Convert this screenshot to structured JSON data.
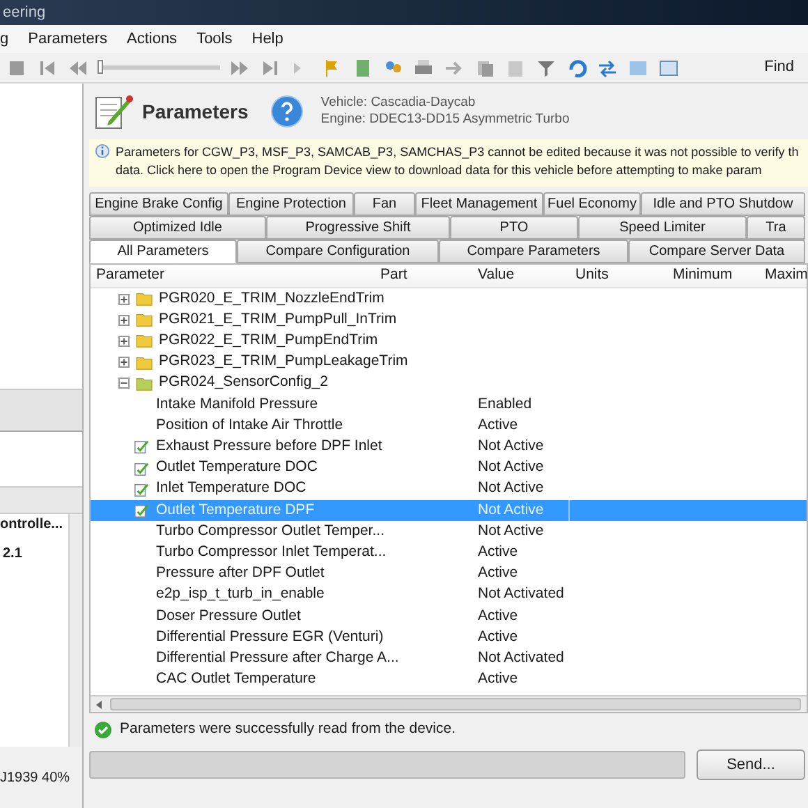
{
  "window": {
    "title": "eering"
  },
  "menu": [
    {
      "label": "g"
    },
    {
      "label": "Parameters"
    },
    {
      "label": "Actions"
    },
    {
      "label": "Tools"
    },
    {
      "label": "Help"
    }
  ],
  "toolbar": {
    "find_label": "Find",
    "slider": {
      "level": 0.0
    }
  },
  "left_panel": {
    "column_header": "ontrolle...",
    "version": "2.1",
    "status": "J1939 40%"
  },
  "header": {
    "title": "Parameters",
    "vehicle": "Vehicle: Cascadia-Daycab",
    "engine": "Engine: DDEC13-DD15 Asymmetric Turbo"
  },
  "banner": {
    "line_1": "Parameters for CGW_P3, MSF_P3, SAMCAB_P3, SAMCHAS_P3 cannot be edited because it was not possible to verify th",
    "line_2": "data. Click here to open the Program Device view to download data for this vehicle before attempting to make param"
  },
  "tab_rows": [
    [
      {
        "label": "Engine Brake Config",
        "selected": false
      },
      {
        "label": "Engine Protection",
        "selected": false
      },
      {
        "label": "Fan",
        "selected": false
      },
      {
        "label": "Fleet Management",
        "selected": false
      },
      {
        "label": "Fuel Economy",
        "selected": false
      },
      {
        "label": "Idle and PTO Shutdow",
        "selected": false
      }
    ],
    [
      {
        "label": "Optimized Idle",
        "selected": false
      },
      {
        "label": "Progressive Shift",
        "selected": false
      },
      {
        "label": "PTO",
        "selected": false
      },
      {
        "label": "Speed Limiter",
        "selected": false
      },
      {
        "label": "Tra",
        "selected": false
      }
    ],
    [
      {
        "label": "All Parameters",
        "selected": true
      },
      {
        "label": "Compare Configuration",
        "selected": false
      },
      {
        "label": "Compare Parameters",
        "selected": false
      },
      {
        "label": "Compare Server Data",
        "selected": false
      }
    ]
  ],
  "table": {
    "columns": [
      "Parameter",
      "Part",
      "Value",
      "Units",
      "Minimum",
      "Maxim"
    ],
    "rows": [
      {
        "name": "PGR020_E_TRIM_NozzleEndTrim",
        "expanded": false,
        "children": []
      },
      {
        "name": "PGR021_E_TRIM_PumpPull_InTrim",
        "expanded": false,
        "children": []
      },
      {
        "name": "PGR022_E_TRIM_PumpEndTrim",
        "expanded": false,
        "children": []
      },
      {
        "name": "PGR023_E_TRIM_PumpLeakageTrim",
        "expanded": false,
        "children": []
      },
      {
        "name": "PGR024_SensorConfig_2",
        "expanded": true,
        "children": [
          {
            "name": "Intake Manifold Pressure",
            "value": "Enabled",
            "edited": false,
            "selected": false
          },
          {
            "name": "Position of Intake Air Throttle",
            "value": "Active",
            "edited": false,
            "selected": false
          },
          {
            "name": "Exhaust Pressure before DPF Inlet",
            "value": "Not Active",
            "edited": true,
            "selected": false
          },
          {
            "name": "Outlet Temperature DOC",
            "value": "Not Active",
            "edited": true,
            "selected": false
          },
          {
            "name": "Inlet Temperature DOC",
            "value": "Not Active",
            "edited": true,
            "selected": false
          },
          {
            "name": "Outlet Temperature DPF",
            "value": "Not Active",
            "edited": true,
            "selected": true
          },
          {
            "name": "Turbo Compressor Outlet Temper...",
            "value": "Not Active",
            "edited": false,
            "selected": false
          },
          {
            "name": "Turbo Compressor Inlet Temperat...",
            "value": "Active",
            "edited": false,
            "selected": false
          },
          {
            "name": "Pressure after DPF Outlet",
            "value": "Active",
            "edited": false,
            "selected": false
          },
          {
            "name": "e2p_isp_t_turb_in_enable",
            "value": "Not Activated",
            "edited": false,
            "selected": false
          },
          {
            "name": "Doser Pressure Outlet",
            "value": "Active",
            "edited": false,
            "selected": false
          },
          {
            "name": "Differential Pressure EGR (Venturi)",
            "value": "Active",
            "edited": false,
            "selected": false
          },
          {
            "name": "Differential Pressure after Charge A...",
            "value": "Not Activated",
            "edited": false,
            "selected": false
          },
          {
            "name": "CAC Outlet Temperature",
            "value": "Active",
            "edited": false,
            "selected": false
          }
        ]
      }
    ]
  },
  "status": {
    "message": "Parameters were successfully read from the device.",
    "progress": {
      "level": 0.0
    },
    "send_button": "Send..."
  }
}
